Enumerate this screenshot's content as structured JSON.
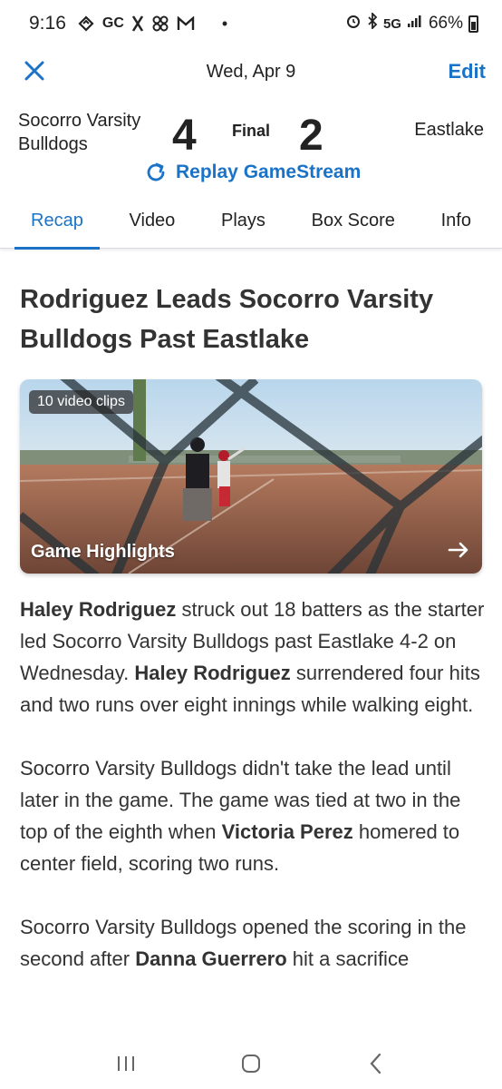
{
  "status_bar": {
    "time": "9:16",
    "icons": [
      "gamechanger-icon",
      "gc-text-icon",
      "x-icon",
      "pinwheel-icon",
      "gmail-icon",
      "dot-icon"
    ],
    "gc_text": "GC",
    "network": "5G",
    "battery": "66%"
  },
  "header": {
    "date": "Wed, Apr 9",
    "edit_label": "Edit"
  },
  "score": {
    "home_team": "Socorro Varsity Bulldogs",
    "home_score": "4",
    "status": "Final",
    "away_score": "2",
    "away_team": "Eastlake",
    "replay_label": "Replay GameStream"
  },
  "tabs": [
    {
      "label": "Recap",
      "active": true
    },
    {
      "label": "Video",
      "active": false
    },
    {
      "label": "Plays",
      "active": false
    },
    {
      "label": "Box Score",
      "active": false
    },
    {
      "label": "Info",
      "active": false
    }
  ],
  "article": {
    "title": "Rodriguez Leads Socorro Varsity Bulldogs Past Eastlake",
    "video": {
      "clips_badge": "10 video clips",
      "label": "Game Highlights"
    },
    "p1": {
      "b1": "Haley Rodriguez",
      "t1": " struck out 18 batters as the starter led Socorro Varsity Bulldogs past Eastlake 4-2 on Wednesday. ",
      "b2": "Haley Rodriguez",
      "t2": " surrendered four hits and two runs over eight innings while walking eight."
    },
    "p2": {
      "t1": "Socorro Varsity Bulldogs didn't take the lead until later in the game. The game was tied at two in the top of the eighth when ",
      "b1": "Victoria Perez",
      "t2": " homered to center field, scoring two runs."
    },
    "p3": {
      "t1": "Socorro Varsity Bulldogs opened the scoring in the second after ",
      "b1": "Danna Guerrero",
      "t2": " hit a sacrifice"
    }
  },
  "colors": {
    "accent": "#1a73c7",
    "text": "#222222"
  }
}
